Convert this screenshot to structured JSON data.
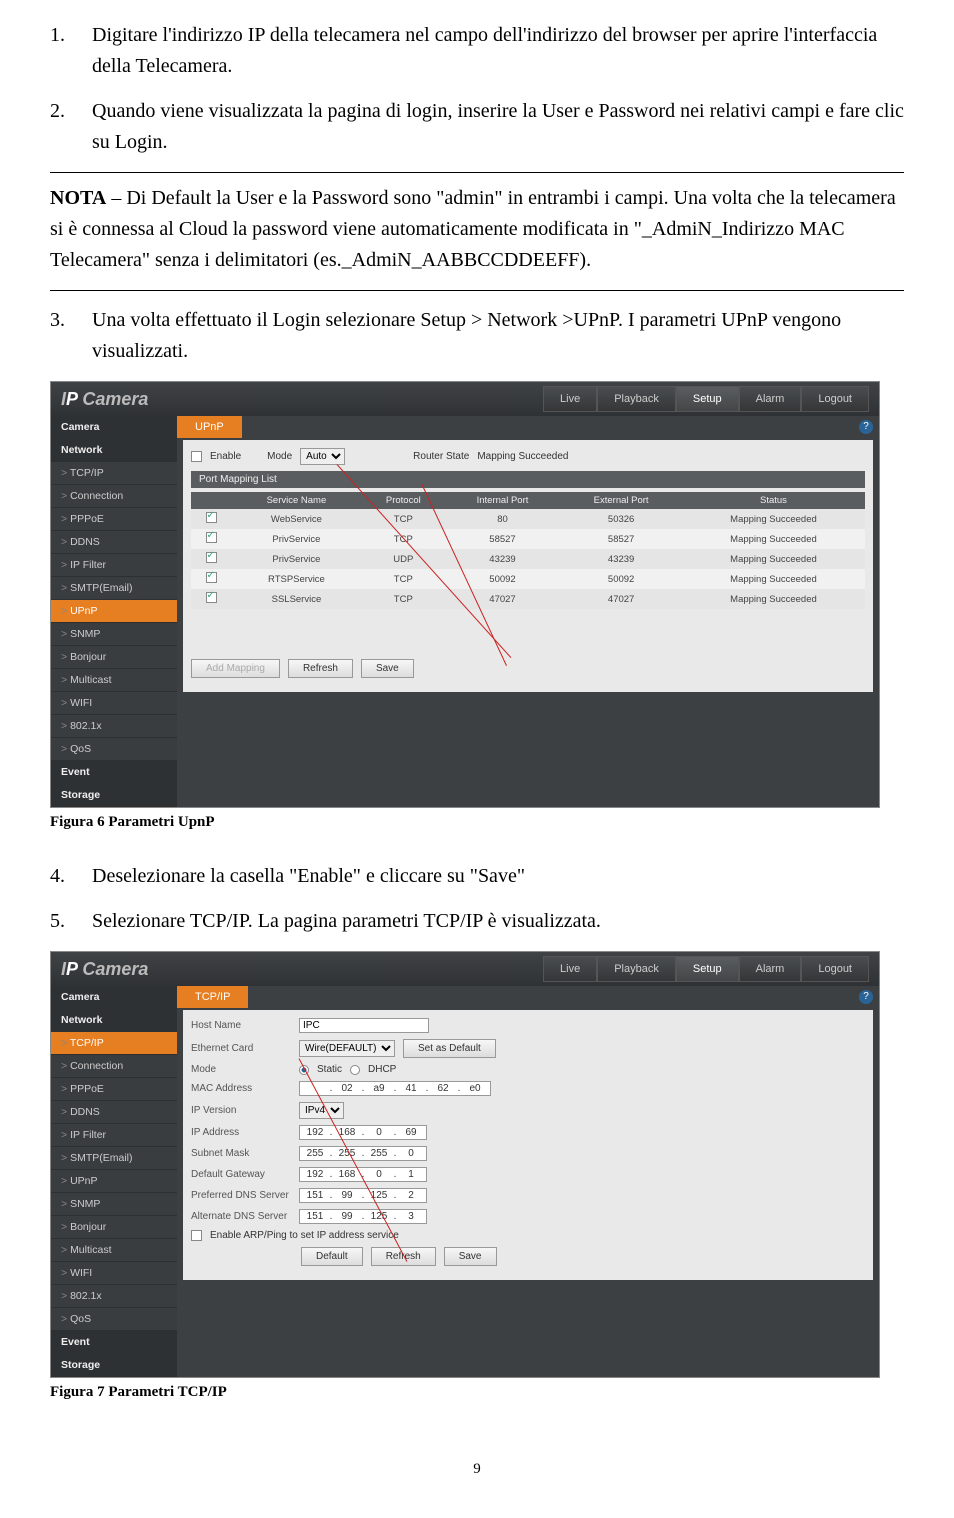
{
  "steps": {
    "s1_num": "1.",
    "s1": "Digitare l'indirizzo IP della telecamera nel campo dell'indirizzo del browser per aprire l'interfaccia della Telecamera.",
    "s2_num": "2.",
    "s2": "Quando viene visualizzata la pagina di login, inserire la User e Password nei relativi campi e fare clic su Login.",
    "s3_num": "3.",
    "s3": "Una volta effettuato il Login selezionare Setup > Network >UPnP. I parametri UPnP vengono visualizzati.",
    "s4_num": "4.",
    "s4": "Deselezionare la casella \"Enable\" e cliccare su \"Save\"",
    "s5_num": "5.",
    "s5": "Selezionare TCP/IP. La pagina parametri TCP/IP  è visualizzata."
  },
  "nota_label": "NOTA",
  "nota_text": " – Di Default  la User e la Password  sono  \"admin\" in entrambi i campi. Una volta che la telecamera si è connessa al Cloud la password viene automaticamente modificata in \"_AdmiN_Indirizzo MAC Telecamera\" senza i delimitatori (es._AdmiN_AABBCCDDEEFF).",
  "brand_i": "I",
  "brand_p": "P",
  "brand_rest": " Camera",
  "topTabs": [
    "Live",
    "Playback",
    "Setup",
    "Alarm",
    "Logout"
  ],
  "selectedTab": "Setup",
  "help": "?",
  "fig6": {
    "caption": "Figura 6 Parametri UpnP",
    "crumb": "UPnP",
    "enable": "Enable",
    "mode": "Mode",
    "modeVal": "Auto",
    "router": "Router State",
    "routerVal": "Mapping Succeeded",
    "listHead": "Port Mapping List",
    "cols": [
      "",
      "Service Name",
      "Protocol",
      "Internal Port",
      "External Port",
      "Status"
    ],
    "rows": [
      [
        "on",
        "WebService",
        "TCP",
        "80",
        "50326",
        "Mapping Succeeded"
      ],
      [
        "on",
        "PrivService",
        "TCP",
        "58527",
        "58527",
        "Mapping Succeeded"
      ],
      [
        "on",
        "PrivService",
        "UDP",
        "43239",
        "43239",
        "Mapping Succeeded"
      ],
      [
        "on",
        "RTSPService",
        "TCP",
        "50092",
        "50092",
        "Mapping Succeeded"
      ],
      [
        "on",
        "SSLService",
        "TCP",
        "47027",
        "47027",
        "Mapping Succeeded"
      ]
    ],
    "btnAdd": "Add Mapping",
    "btnRefresh": "Refresh",
    "btnSave": "Save",
    "sidebar": [
      "Camera",
      "Network",
      "TCP/IP",
      "Connection",
      "PPPoE",
      "DDNS",
      "IP Filter",
      "SMTP(Email)",
      "UPnP",
      "SNMP",
      "Bonjour",
      "Multicast",
      "WIFI",
      "802.1x",
      "QoS",
      "Event",
      "Storage"
    ]
  },
  "fig7": {
    "caption": "Figura 7 Parametri TCP/IP",
    "crumb": "TCP/IP",
    "labels": {
      "host": "Host Name",
      "hostVal": "IPC",
      "eth": "Ethernet Card",
      "ethVal": "Wire(DEFAULT)",
      "setDef": "Set as Default",
      "mode": "Mode",
      "static": "Static",
      "dhcp": "DHCP",
      "mac": "MAC Address",
      "macVal": [
        "",
        "02",
        "a9",
        "41",
        "62",
        "e0"
      ],
      "ipver": "IP Version",
      "ipverVal": "IPv4",
      "ipaddr": "IP Address",
      "ipaddrVal": [
        "192",
        "168",
        "0",
        "69"
      ],
      "mask": "Subnet Mask",
      "maskVal": [
        "255",
        "255",
        "255",
        "0"
      ],
      "gw": "Default Gateway",
      "gwVal": [
        "192",
        "168",
        "0",
        "1"
      ],
      "dns1": "Preferred DNS Server",
      "dns1Val": [
        "151",
        "99",
        "125",
        "2"
      ],
      "dns2": "Alternate DNS Server",
      "dns2Val": [
        "151",
        "99",
        "125",
        "3"
      ],
      "arp": "Enable ARP/Ping to set IP address service",
      "btnDefault": "Default",
      "btnRefresh": "Refresh",
      "btnSave": "Save"
    },
    "sidebar": [
      "Camera",
      "Network",
      "TCP/IP",
      "Connection",
      "PPPoE",
      "DDNS",
      "IP Filter",
      "SMTP(Email)",
      "UPnP",
      "SNMP",
      "Bonjour",
      "Multicast",
      "WIFI",
      "802.1x",
      "QoS",
      "Event",
      "Storage"
    ]
  },
  "pagenum": "9"
}
